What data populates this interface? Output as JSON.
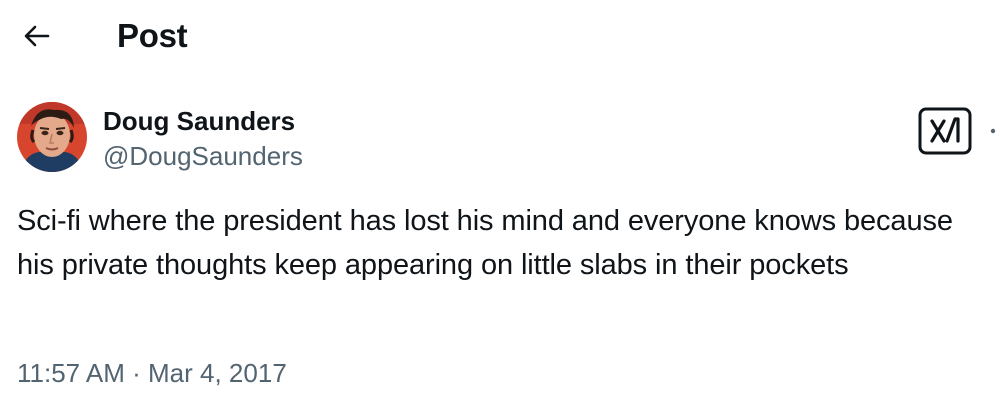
{
  "header": {
    "back_icon": "arrow-left-icon",
    "title": "Post"
  },
  "author": {
    "avatar_icon": "profile-avatar",
    "name": "Doug Saunders",
    "handle": "@DougSaunders"
  },
  "actions": {
    "grok_icon": "grok-icon",
    "more_icon": "more-options-icon"
  },
  "post": {
    "text": "Sci-fi where the president has lost his mind and everyone knows because his private thoughts keep appearing on little slabs in their pockets",
    "timestamp": "11:57 AM · Mar 4, 2017"
  },
  "colors": {
    "primary_text": "#0f1419",
    "secondary_text": "#536471",
    "background": "#ffffff"
  }
}
